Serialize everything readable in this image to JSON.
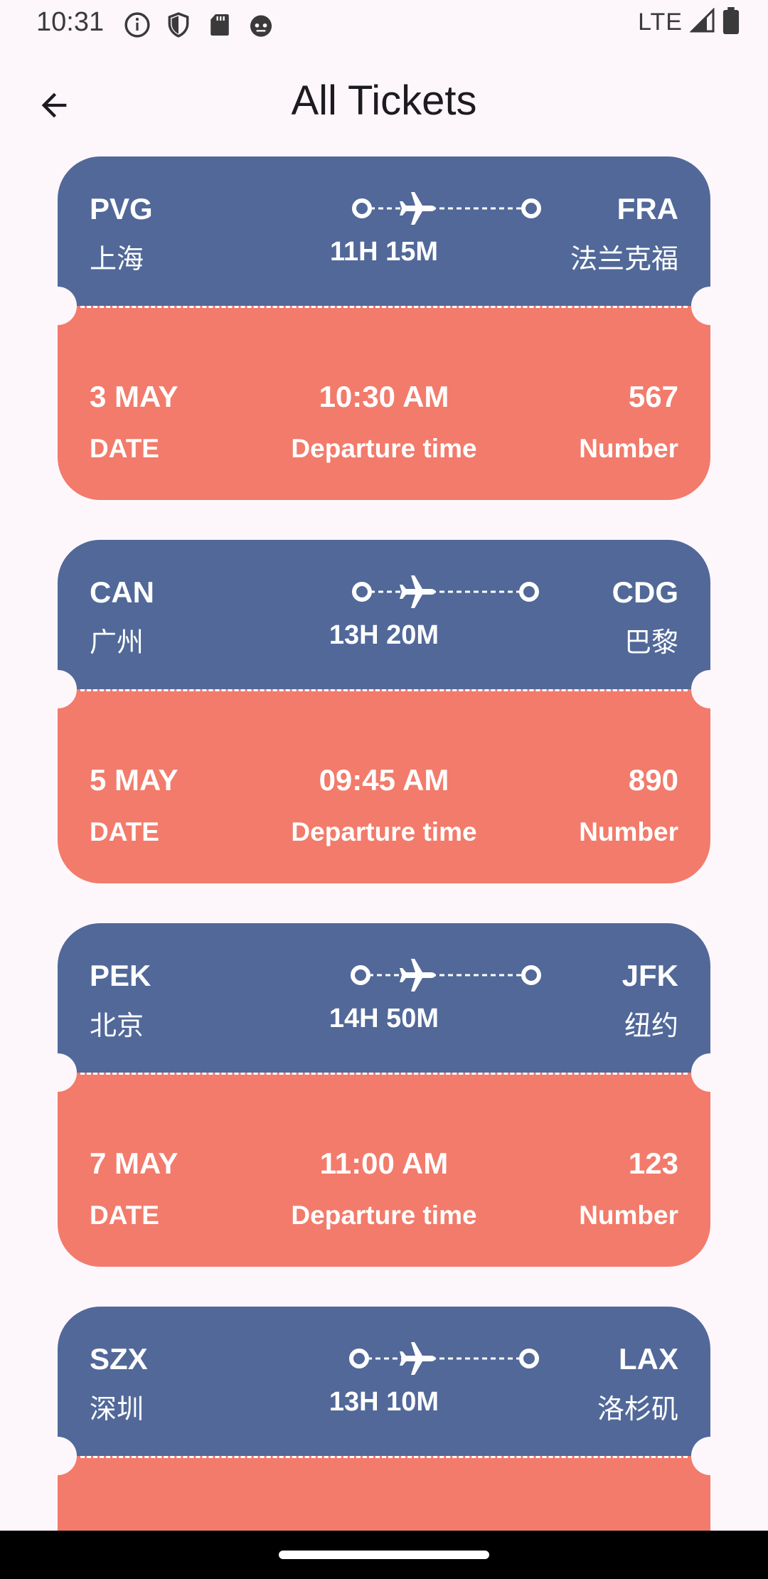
{
  "status_bar": {
    "time": "10:31",
    "network": "LTE",
    "icons": [
      "info-icon",
      "shield-icon",
      "sd-card-icon",
      "android-icon",
      "signal-icon",
      "battery-icon"
    ]
  },
  "header": {
    "title": "All Tickets",
    "back_icon": "arrow-back-icon"
  },
  "colors": {
    "ticket_top": "#516899",
    "ticket_bottom": "#f27b6b",
    "background": "#fdf7fc"
  },
  "labels": {
    "date": "DATE",
    "departure": "Departure time",
    "number": "Number"
  },
  "tickets": [
    {
      "from_code": "PVG",
      "from_city": "上海",
      "to_code": "FRA",
      "to_city": "法兰克福",
      "duration": "11H 15M",
      "date": "3 MAY",
      "time": "10:30 AM",
      "number": "567"
    },
    {
      "from_code": "CAN",
      "from_city": "广州",
      "to_code": "CDG",
      "to_city": "巴黎",
      "duration": "13H 20M",
      "date": "5 MAY",
      "time": "09:45 AM",
      "number": "890"
    },
    {
      "from_code": "PEK",
      "from_city": "北京",
      "to_code": "JFK",
      "to_city": "纽约",
      "duration": "14H 50M",
      "date": "7 MAY",
      "time": "11:00 AM",
      "number": "123"
    },
    {
      "from_code": "SZX",
      "from_city": "深圳",
      "to_code": "LAX",
      "to_city": "洛杉矶",
      "duration": "13H 10M",
      "date": "",
      "time": "",
      "number": ""
    }
  ]
}
